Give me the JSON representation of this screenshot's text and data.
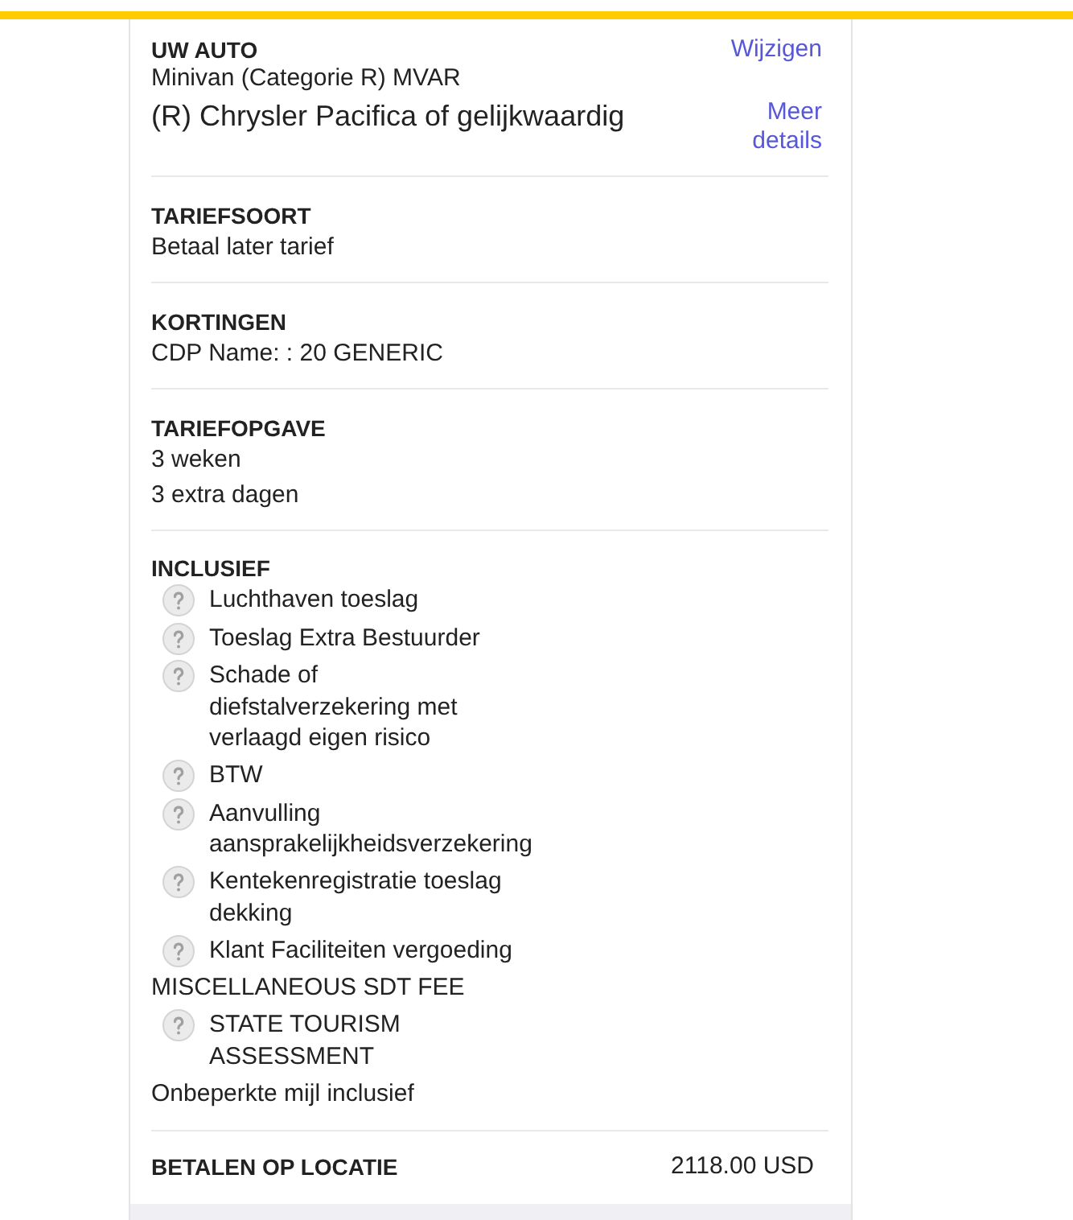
{
  "vehicle": {
    "heading": "UW AUTO",
    "category": "Minivan (Categorie R) MVAR",
    "model": "(R) Chrysler Pacifica of gelijkwaardig",
    "change_link": "Wijzigen",
    "details_link": "Meer details"
  },
  "sections": [
    {
      "heading": "TARIEFSOORT",
      "lines": [
        "Betaal later tarief"
      ]
    },
    {
      "heading": "KORTINGEN",
      "lines": [
        "CDP Name: : 20 GENERIC"
      ]
    },
    {
      "heading": "TARIEFOPGAVE",
      "lines": [
        "3 weken",
        "3 extra dagen"
      ]
    }
  ],
  "inclusions": {
    "heading": "INCLUSIEF",
    "items": [
      {
        "kind": "fee",
        "label": "Luchthaven toeslag"
      },
      {
        "kind": "fee",
        "label": "Toeslag Extra Bestuurder"
      },
      {
        "kind": "fee",
        "label": "Schade of diefstalverzekering met verlaagd eigen risico"
      },
      {
        "kind": "fee",
        "label": "BTW"
      },
      {
        "kind": "fee",
        "label": "Aanvulling aansprakelijkheidsverzekering"
      },
      {
        "kind": "fee",
        "label": "Kentekenregistratie toeslag dekking"
      },
      {
        "kind": "fee",
        "label": "Klant Faciliteiten vergoeding"
      },
      {
        "kind": "note",
        "label": "MISCELLANEOUS SDT FEE"
      },
      {
        "kind": "fee",
        "label": "STATE TOURISM ASSESSMENT"
      },
      {
        "kind": "note",
        "label": "Onbeperkte mijl inclusief"
      }
    ]
  },
  "total": {
    "label": "BETALEN OP LOCATIE",
    "amount": "2118.00 USD"
  }
}
